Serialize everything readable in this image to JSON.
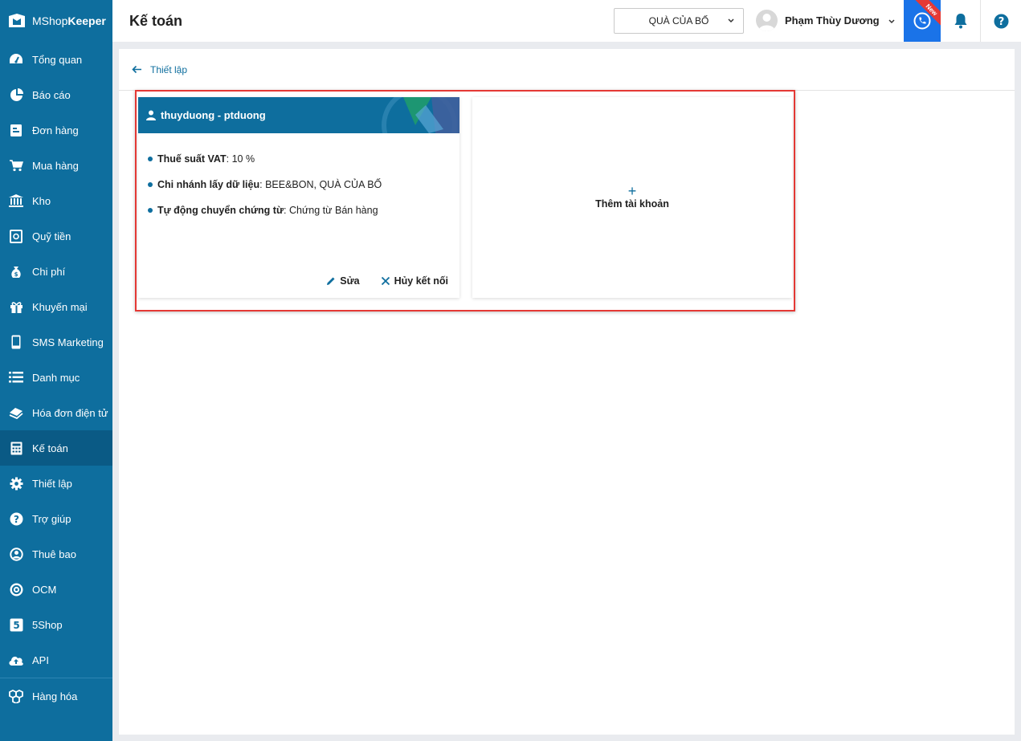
{
  "brand": {
    "name_light": "MShop",
    "name_bold": "Keeper"
  },
  "sidebar": {
    "items": [
      {
        "label": "Tổng quan",
        "icon": "dashboard-icon"
      },
      {
        "label": "Báo cáo",
        "icon": "pie-chart-icon"
      },
      {
        "label": "Đơn hàng",
        "icon": "order-icon"
      },
      {
        "label": "Mua hàng",
        "icon": "cart-icon"
      },
      {
        "label": "Kho",
        "icon": "warehouse-icon"
      },
      {
        "label": "Quỹ tiền",
        "icon": "safe-icon"
      },
      {
        "label": "Chi phí",
        "icon": "money-bag-icon"
      },
      {
        "label": "Khuyến mại",
        "icon": "gift-icon"
      },
      {
        "label": "SMS Marketing",
        "icon": "phone-icon"
      },
      {
        "label": "Danh mục",
        "icon": "list-icon"
      },
      {
        "label": "Hóa đơn điện tử",
        "icon": "invoice-icon"
      },
      {
        "label": "Kế toán",
        "icon": "calculator-icon",
        "active": true
      },
      {
        "label": "Thiết lập",
        "icon": "gear-icon"
      },
      {
        "label": "Trợ giúp",
        "icon": "help-icon"
      },
      {
        "label": "Thuê bao",
        "icon": "user-circle-icon"
      },
      {
        "label": "OCM",
        "icon": "ocm-icon"
      },
      {
        "label": "5Shop",
        "icon": "5shop-icon"
      },
      {
        "label": "API",
        "icon": "cloud-upload-icon"
      },
      {
        "label": "Hàng hóa",
        "icon": "boxes-icon"
      }
    ]
  },
  "header": {
    "title": "Kế toán",
    "store": "QUÀ CỦA BỐ",
    "user_name": "Phạm Thùy Dương",
    "new_badge": "New"
  },
  "breadcrumb": {
    "label": "Thiết lập"
  },
  "account_card": {
    "title": "thuyduong - ptduong",
    "rows": [
      {
        "key": "Thuế suất VAT",
        "value": ": 10 %"
      },
      {
        "key": "Chi nhánh lấy dữ liệu",
        "value": ": BEE&BON, QUÀ CỦA BỐ"
      },
      {
        "key": "Tự động chuyển chứng từ",
        "value": ": Chứng từ Bán hàng"
      }
    ],
    "edit_label": "Sửa",
    "disconnect_label": "Hủy kết nối"
  },
  "add_card": {
    "plus": "+",
    "label": "Thêm tài khoản"
  },
  "colors": {
    "primary": "#0e6e9e",
    "active": "#0a5a85",
    "highlight": "#e53935",
    "phone": "#1a73e8"
  }
}
